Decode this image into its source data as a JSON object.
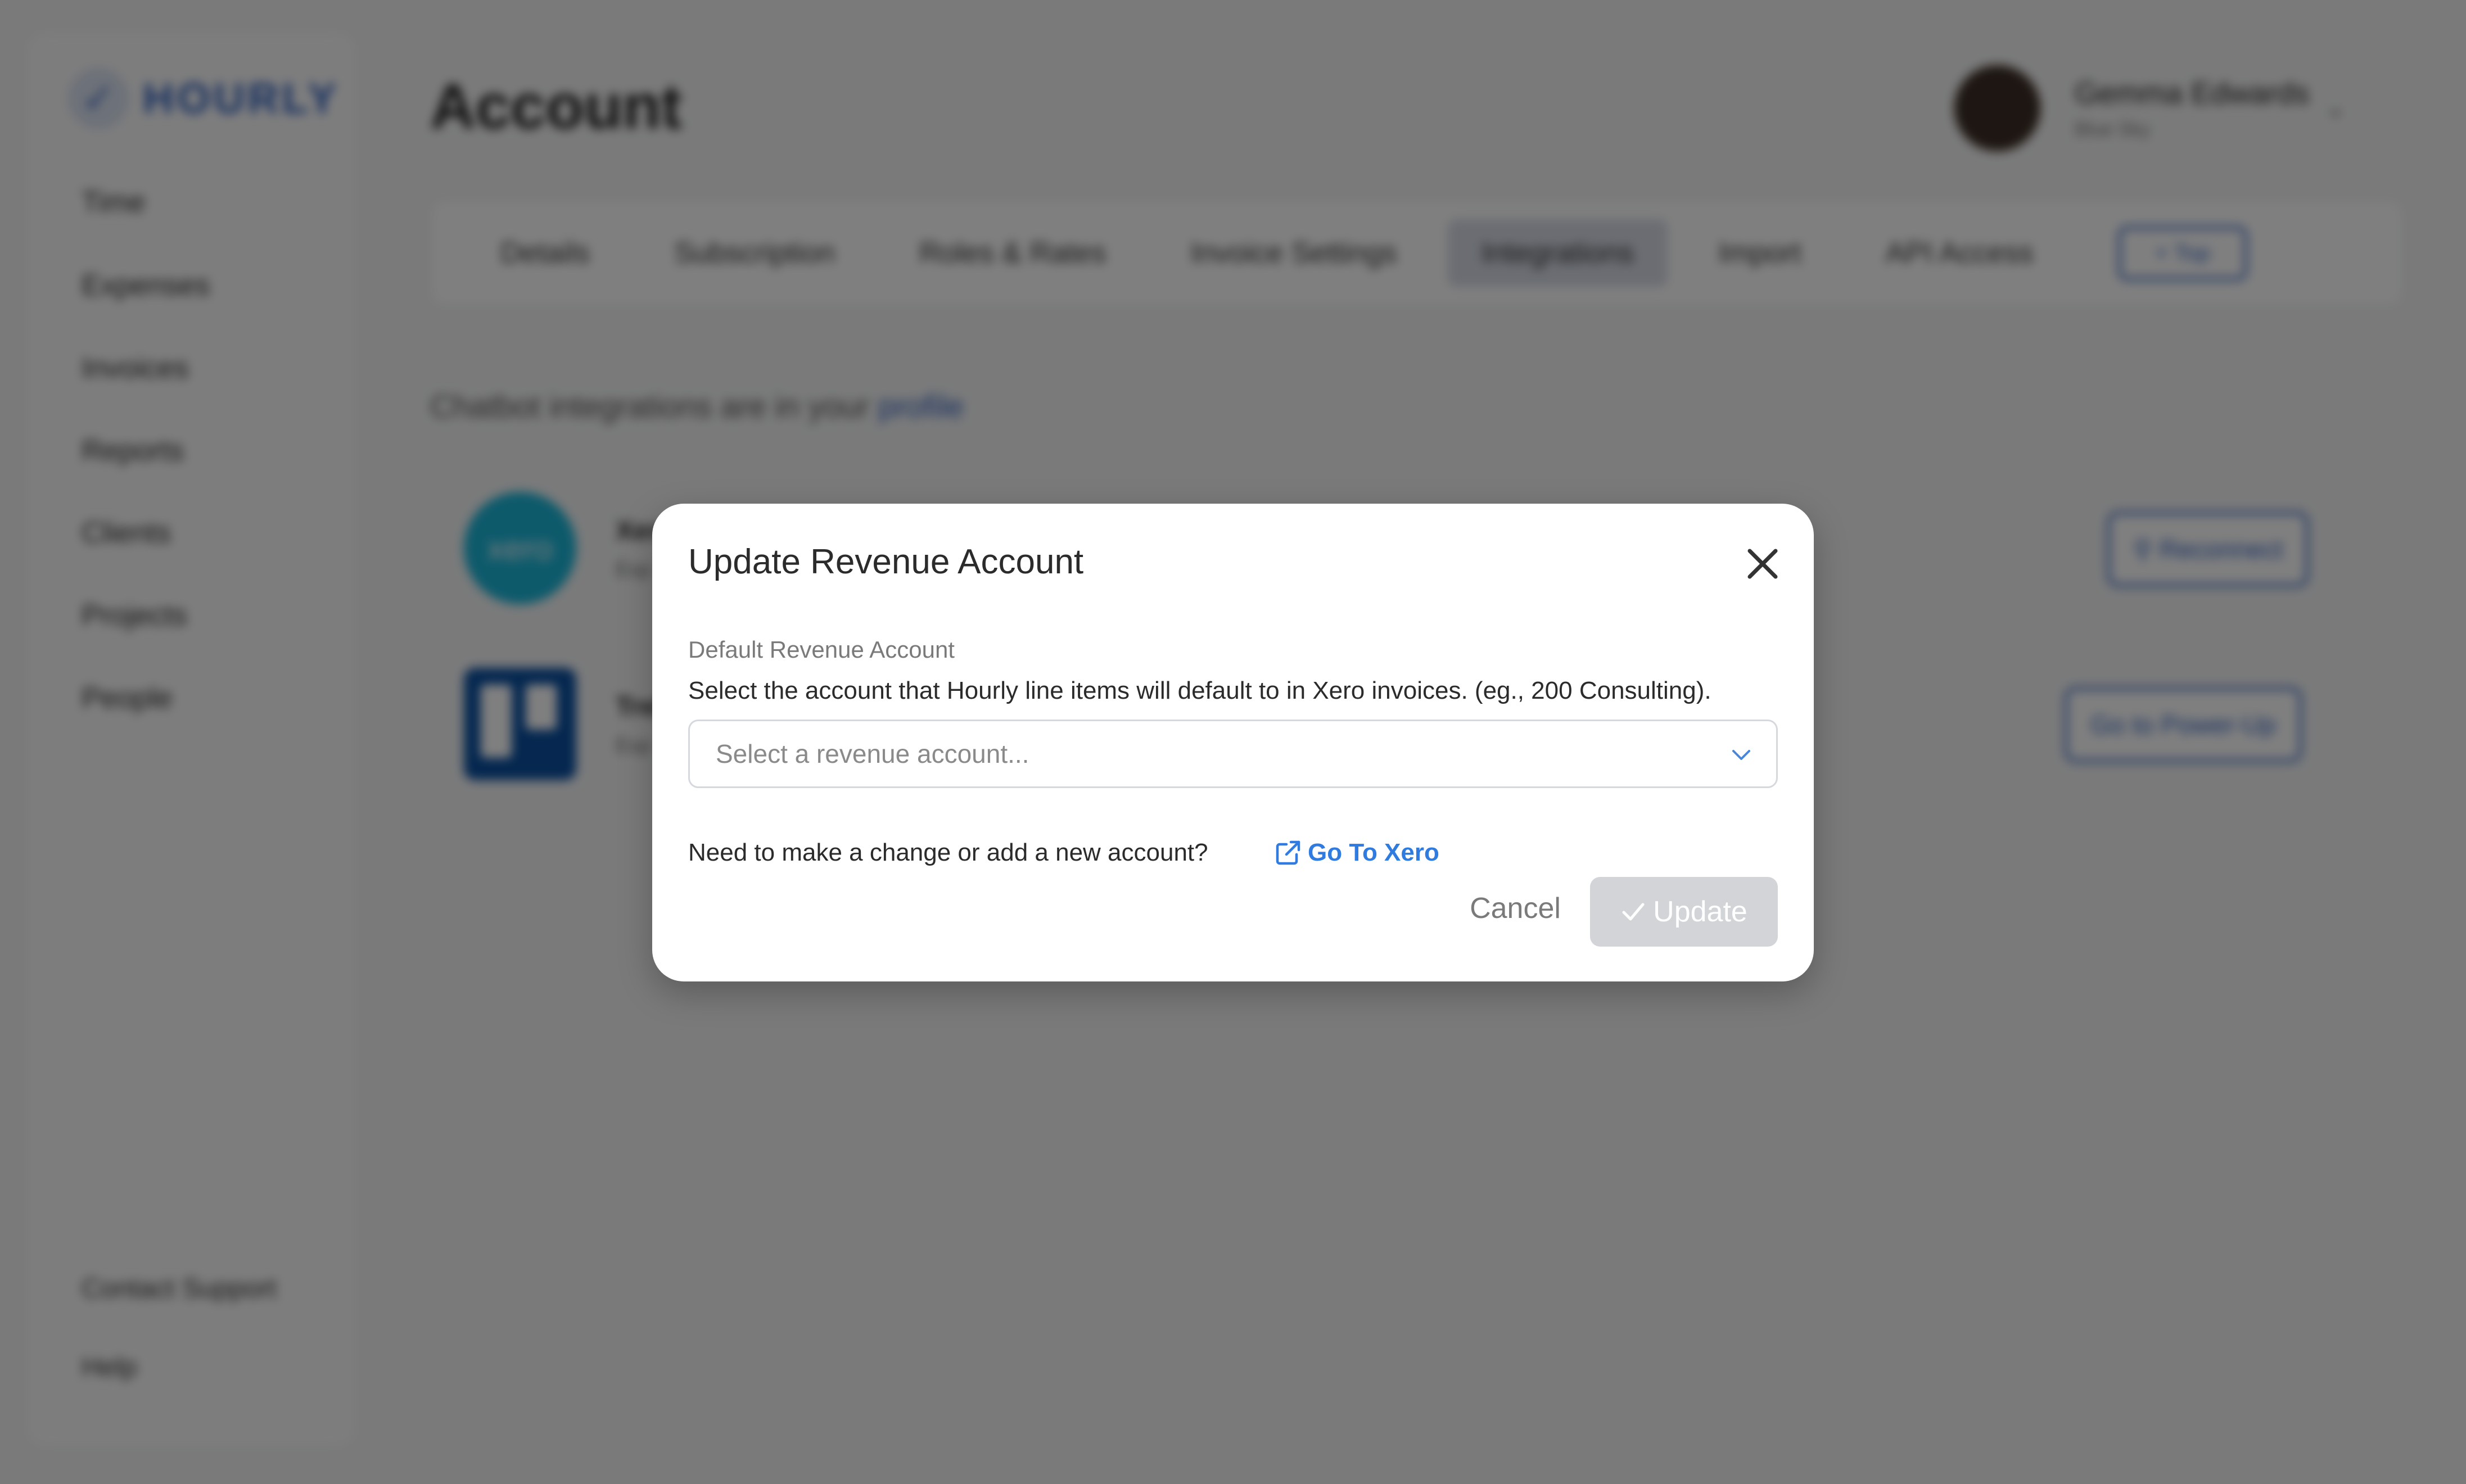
{
  "app": {
    "brand": "HOURLY",
    "page_title": "Account",
    "nav": [
      "Time",
      "Expenses",
      "Invoices",
      "Reports",
      "Clients",
      "Projects",
      "People"
    ],
    "nav_bottom": [
      "Contact Support",
      "Help"
    ],
    "user": {
      "name": "Gemma Edwards",
      "org": "Blue Sky"
    },
    "tabs": [
      "Details",
      "Subscription",
      "Roles & Rates",
      "Invoice Settings",
      "Integrations",
      "Import",
      "API Access"
    ],
    "active_tab": "Integrations",
    "top_button": "Top",
    "chatbot_note": "Chatbot integrations are in your",
    "chatbot_link": "profile",
    "integrations": [
      {
        "name": "Xero",
        "logo_text": "xero",
        "desc": "Exp",
        "button": "Reconnect"
      },
      {
        "name": "Trello",
        "desc": "Exp",
        "button": "Go to Power-Up"
      }
    ]
  },
  "modal": {
    "title": "Update Revenue Account",
    "field_label": "Default Revenue Account",
    "field_help": "Select the account that Hourly line items will default to in Xero invoices. (eg., 200 Consulting).",
    "select_placeholder": "Select a revenue account...",
    "change_note": "Need to make a change or add a new account?",
    "go_link": "Go To Xero",
    "cancel": "Cancel",
    "update": "Update"
  },
  "colors": {
    "overlay": "#000000",
    "link": "#2f7be0",
    "update_disabled": "#d2d4d8",
    "brand": "#2f5fbf"
  },
  "icons": {
    "close": "close-icon",
    "chevron": "chevron-down-icon",
    "external": "external-link-icon",
    "check": "check-icon"
  }
}
